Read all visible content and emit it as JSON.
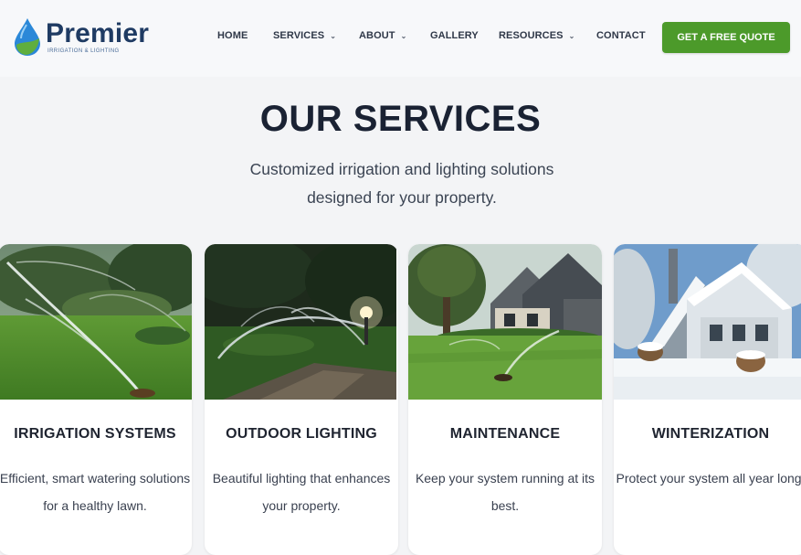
{
  "brand": {
    "name": "Premier",
    "tagline": "Irrigation & Lighting"
  },
  "nav": {
    "items": [
      {
        "label": "HOME",
        "dropdown": false
      },
      {
        "label": "SERVICES",
        "dropdown": true
      },
      {
        "label": "ABOUT",
        "dropdown": true
      },
      {
        "label": "GALLERY",
        "dropdown": false
      },
      {
        "label": "RESOURCES",
        "dropdown": true
      },
      {
        "label": "CONTACT",
        "dropdown": false
      }
    ],
    "cta_label": "GET A FREE QUOTE"
  },
  "services": {
    "title": "OUR SERVICES",
    "subtitle": "Customized irrigation and lighting solutions designed for your property.",
    "cards": [
      {
        "title": "IRRIGATION SYSTEMS",
        "description": "Efficient, smart watering solutions for a healthy lawn.",
        "image_icon": "sprinkler-lawn-photo"
      },
      {
        "title": "OUTDOOR LIGHTING",
        "description": "Beautiful lighting that enhances your property.",
        "image_icon": "night-lighting-photo"
      },
      {
        "title": "MAINTENANCE",
        "description": "Keep your system running at its best.",
        "image_icon": "house-lawn-photo"
      },
      {
        "title": "WINTERIZATION",
        "description": "Protect your system all year long.",
        "image_icon": "snow-house-photo"
      }
    ]
  },
  "colors": {
    "brand_navy": "#1f3b63",
    "brand_blue": "#2b88d8",
    "brand_green": "#4c9a2a",
    "background": "#f3f4f6"
  }
}
